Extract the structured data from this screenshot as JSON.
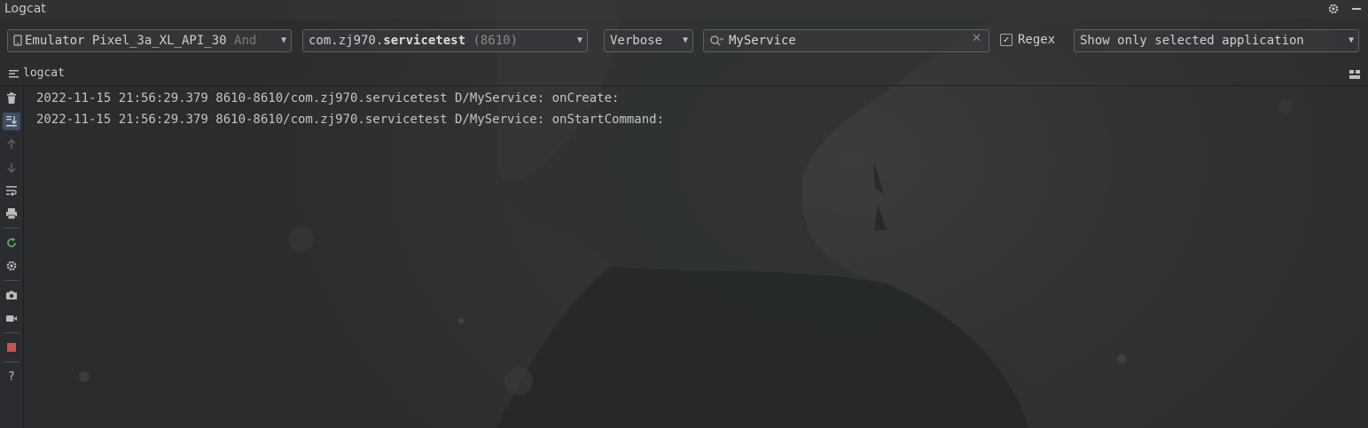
{
  "window": {
    "title": "Logcat"
  },
  "toolbar": {
    "device": {
      "name": "Emulator Pixel_3a_XL_API_30",
      "suffix": "And"
    },
    "process": {
      "package_prefix": "com.zj970.",
      "package_name": "servicetest",
      "pid": "(8610)"
    },
    "log_level": "Verbose",
    "search": {
      "value": "MyService",
      "placeholder": ""
    },
    "regex": {
      "label": "Regex",
      "checked": true
    },
    "filter": "Show only selected application"
  },
  "tab": {
    "label": "logcat"
  },
  "log": {
    "lines": [
      "2022-11-15 21:56:29.379 8610-8610/com.zj970.servicetest D/MyService: onCreate:",
      "2022-11-15 21:56:29.379 8610-8610/com.zj970.servicetest D/MyService: onStartCommand:"
    ]
  },
  "sidebar": {
    "tools": [
      {
        "icon": "trash-icon"
      },
      {
        "icon": "scroll-to-end-icon"
      },
      {
        "icon": "arrow-up-icon"
      },
      {
        "icon": "arrow-down-icon"
      },
      {
        "icon": "soft-wrap-icon"
      },
      {
        "icon": "print-icon"
      },
      {
        "icon": "restart-icon"
      },
      {
        "icon": "gear-icon"
      },
      {
        "icon": "camera-icon"
      },
      {
        "icon": "video-camera-icon"
      },
      {
        "icon": "stop-icon"
      },
      {
        "icon": "help-icon"
      }
    ]
  },
  "colors": {
    "background": "#2c2e30",
    "text": "#c4c4c4",
    "restart_green": "#5fa760",
    "stop_red": "#c75450"
  }
}
